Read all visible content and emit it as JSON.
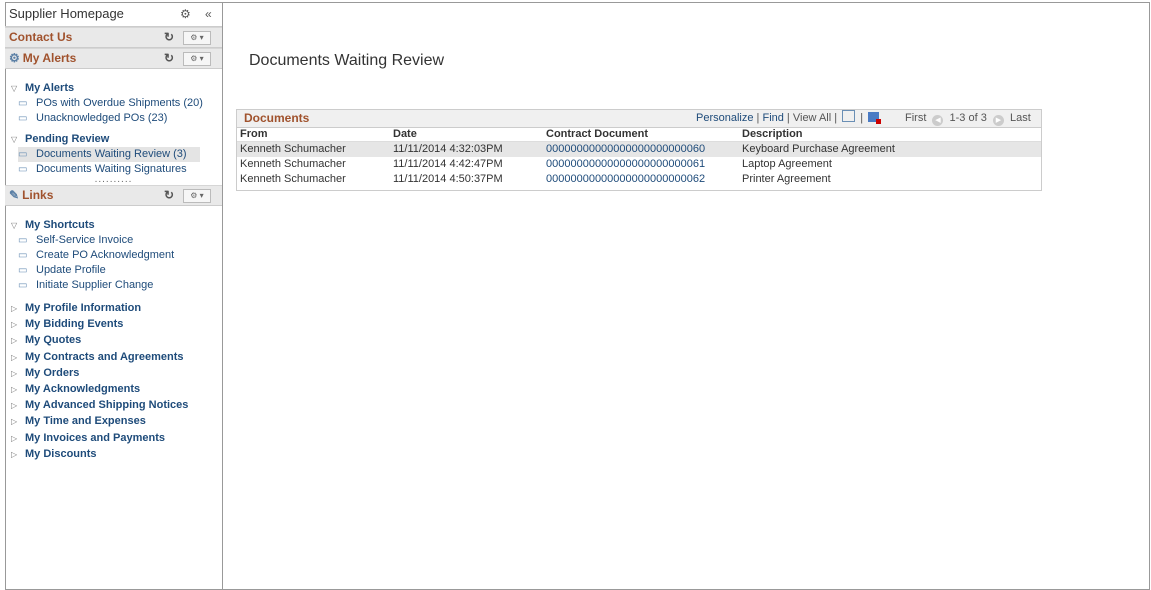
{
  "sidebar": {
    "title": "Supplier Homepage",
    "collapse_icon": "«",
    "contact_us": "Contact Us",
    "my_alerts_pagelet": "My Alerts",
    "alerts": {
      "group_title": "My Alerts",
      "items": [
        "POs with Overdue Shipments (20)",
        "Unacknowledged POs (23)"
      ],
      "pending_title": "Pending Review",
      "pending_items": [
        "Documents Waiting Review (3)",
        "Documents Waiting Signatures"
      ]
    },
    "drag_handle": "..........",
    "links_pagelet": "Links",
    "shortcuts_title": "My Shortcuts",
    "shortcuts": [
      "Self-Service Invoice",
      "Create PO Acknowledgment",
      "Update Profile",
      "Initiate Supplier Change"
    ],
    "sections": [
      "My Profile Information",
      "My Bidding Events",
      "My Quotes",
      "My Contracts and Agreements",
      "My Orders",
      "My Acknowledgments",
      "My Advanced Shipping Notices",
      "My Time and Expenses",
      "My Invoices and Payments",
      "My Discounts"
    ]
  },
  "main": {
    "title": "Documents Waiting Review",
    "grid": {
      "title": "Documents",
      "personalize": "Personalize",
      "find": "Find",
      "view_all": "View All",
      "first": "First",
      "range": "1-3 of 3",
      "last": "Last",
      "columns": [
        "From",
        "Date",
        "Contract Document",
        "Description"
      ],
      "rows": [
        [
          "Kenneth Schumacher",
          "11/11/2014  4:32:03PM",
          "00000000000000000000000060",
          "Keyboard Purchase Agreement"
        ],
        [
          "Kenneth Schumacher",
          "11/11/2014  4:42:47PM",
          "00000000000000000000000061",
          "Laptop Agreement"
        ],
        [
          "Kenneth Schumacher",
          "11/11/2014  4:50:37PM",
          "00000000000000000000000062",
          "Printer Agreement"
        ]
      ]
    }
  }
}
